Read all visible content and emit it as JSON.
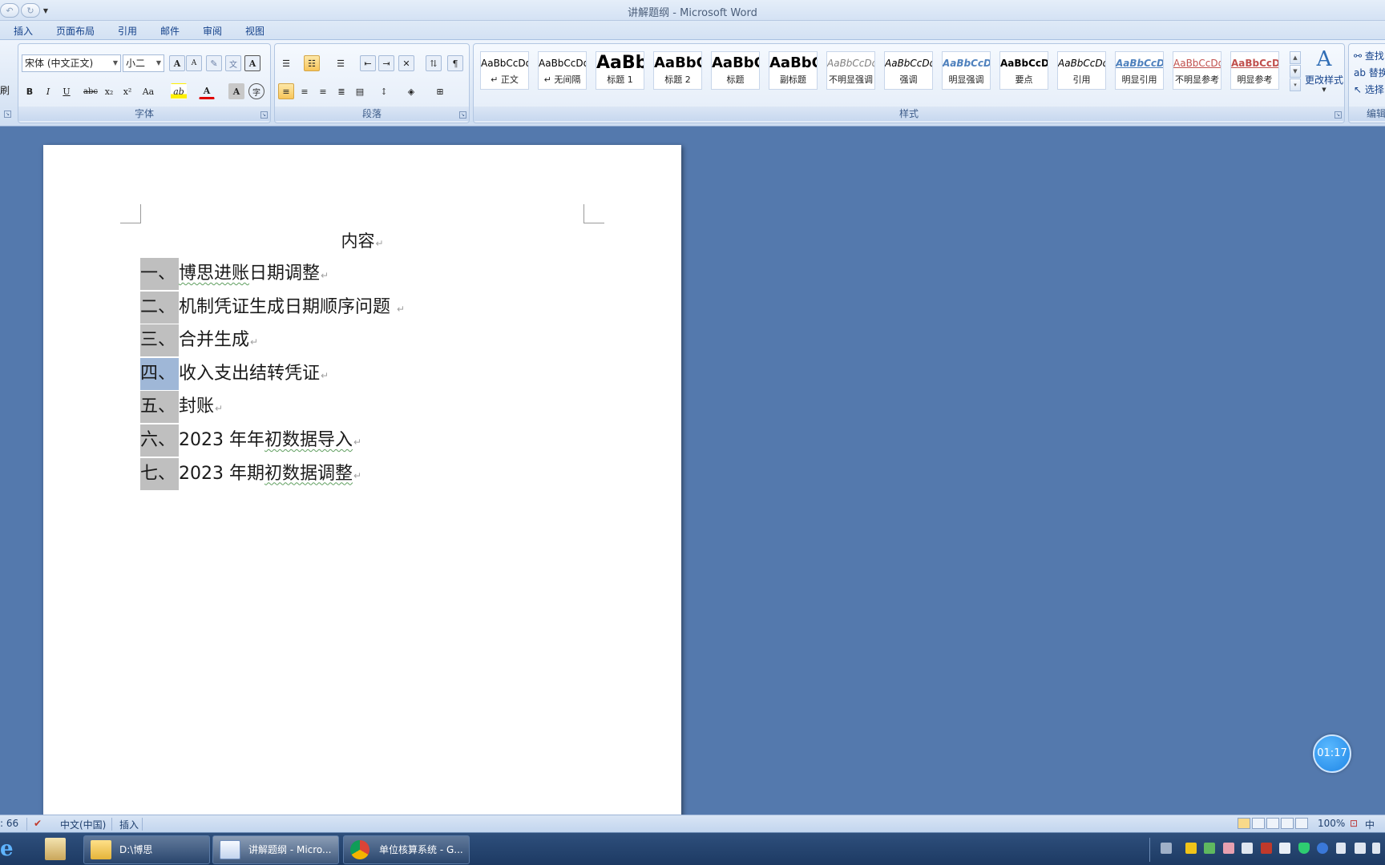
{
  "window": {
    "title": "讲解题纲 - Microsoft Word"
  },
  "quick_access": {
    "undo_icon": "undo-icon",
    "redo_icon": "redo-icon",
    "customize_icon": "dropdown-arrow-icon"
  },
  "tabs": [
    "插入",
    "页面布局",
    "引用",
    "邮件",
    "审阅",
    "视图"
  ],
  "clipboard": {
    "format_painter_label": "刷"
  },
  "font": {
    "group_label": "字体",
    "font_name": "宋体 (中文正文)",
    "font_size": "小二",
    "grow_label": "A",
    "shrink_label": "A",
    "bold": "B",
    "italic": "I",
    "underline": "U",
    "strike": "abc",
    "subscript": "x₂",
    "superscript": "x²",
    "change_case": "Aa",
    "highlight": "ab",
    "font_color": "A",
    "char_shading": "A",
    "enclose": "字"
  },
  "paragraph": {
    "group_label": "段落"
  },
  "styles": {
    "group_label": "样式",
    "change_styles_label": "更改样式",
    "items": [
      {
        "sample": "AaBbCcDd",
        "name": "↵ 正文",
        "color": "#000000"
      },
      {
        "sample": "AaBbCcDd",
        "name": "↵ 无间隔",
        "color": "#000000"
      },
      {
        "sample": "AaBb",
        "name": "标题 1",
        "color": "#000000"
      },
      {
        "sample": "AaBbC",
        "name": "标题 2",
        "color": "#000000"
      },
      {
        "sample": "AaBbC",
        "name": "标题",
        "color": "#000000"
      },
      {
        "sample": "AaBbC",
        "name": "副标题",
        "color": "#000000"
      },
      {
        "sample": "AaBbCcDd",
        "name": "不明显强调",
        "color": "#808080"
      },
      {
        "sample": "AaBbCcDd",
        "name": "强调",
        "color": "#000000"
      },
      {
        "sample": "AaBbCcDd",
        "name": "明显强调",
        "color": "#4f81bd"
      },
      {
        "sample": "AaBbCcDd",
        "name": "要点",
        "color": "#000000"
      },
      {
        "sample": "AaBbCcDd",
        "name": "引用",
        "color": "#000000"
      },
      {
        "sample": "AaBbCcDd",
        "name": "明显引用",
        "color": "#4f81bd"
      },
      {
        "sample": "AaBbCcDd",
        "name": "不明显参考",
        "color": "#c0504d"
      },
      {
        "sample": "AaBbCcDd",
        "name": "明显参考",
        "color": "#c0504d"
      }
    ]
  },
  "editing": {
    "group_label": "编辑",
    "find": "查找",
    "replace": "替换",
    "select": "选择"
  },
  "document": {
    "heading": "内容",
    "items": [
      {
        "num": "一、",
        "text_a": "博思进账",
        "text_b": "日期调整"
      },
      {
        "num": "二、",
        "text_a": "",
        "text_b": "机制凭证生成日期顺序问题 "
      },
      {
        "num": "三、",
        "text_a": "",
        "text_b": "合并生成"
      },
      {
        "num": "四、",
        "text_a": "",
        "text_b": "收入支出结转凭证"
      },
      {
        "num": "五、",
        "text_a": "",
        "text_b": "封账"
      },
      {
        "num": "六、",
        "text_a": "2023 年年",
        "text_b": "初数据导入"
      },
      {
        "num": "七、",
        "text_a": "2023 年期",
        "text_b": "初数据调整"
      }
    ]
  },
  "timer": "01:17",
  "status": {
    "word_count": ": 66",
    "language": "中文(中国)",
    "mode": "插入",
    "zoom": "100%",
    "ime": "中"
  },
  "taskbar": {
    "items": [
      {
        "label": "D:\\博思"
      },
      {
        "label": "讲解题纲 - Micro..."
      },
      {
        "label": "单位核算系统 - G..."
      }
    ]
  }
}
